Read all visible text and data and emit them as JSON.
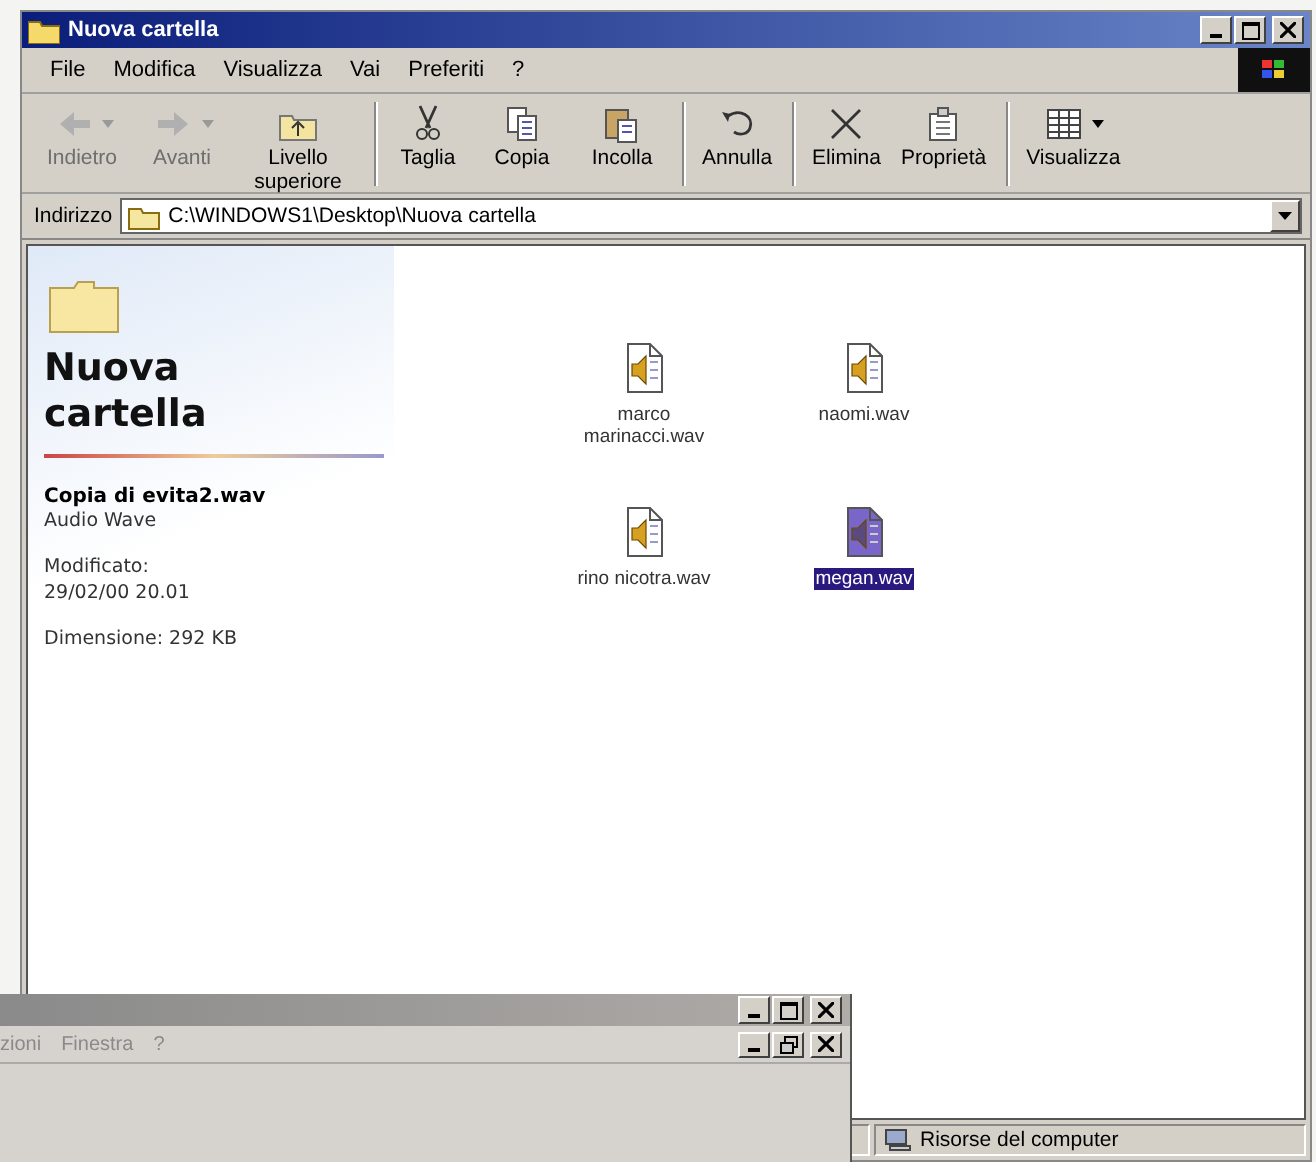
{
  "window": {
    "title": "Nuova cartella"
  },
  "menu": [
    {
      "label": "File"
    },
    {
      "label": "Modifica"
    },
    {
      "label": "Visualizza"
    },
    {
      "label": "Vai"
    },
    {
      "label": "Preferiti"
    },
    {
      "label": "?"
    }
  ],
  "toolbar": [
    {
      "kind": "back",
      "label": "Indietro",
      "disabled": true,
      "dropdown": true,
      "separator_before": false
    },
    {
      "kind": "forward",
      "label": "Avanti",
      "disabled": true,
      "dropdown": true,
      "separator_before": false
    },
    {
      "kind": "up",
      "label": "Livello superiore",
      "disabled": false,
      "dropdown": false,
      "separator_before": false
    },
    {
      "kind": "cut",
      "label": "Taglia",
      "disabled": false,
      "dropdown": false,
      "separator_before": true
    },
    {
      "kind": "copy",
      "label": "Copia",
      "disabled": false,
      "dropdown": false,
      "separator_before": false
    },
    {
      "kind": "paste",
      "label": "Incolla",
      "disabled": false,
      "dropdown": false,
      "separator_before": false
    },
    {
      "kind": "undo",
      "label": "Annulla",
      "disabled": false,
      "dropdown": false,
      "separator_before": true
    },
    {
      "kind": "delete",
      "label": "Elimina",
      "disabled": false,
      "dropdown": false,
      "separator_before": true
    },
    {
      "kind": "properties",
      "label": "Proprietà",
      "disabled": false,
      "dropdown": false,
      "separator_before": false
    },
    {
      "kind": "views",
      "label": "Visualizza",
      "disabled": false,
      "dropdown": true,
      "separator_before": true
    }
  ],
  "address": {
    "label": "Indirizzo",
    "value": "C:\\WINDOWS1\\Desktop\\Nuova cartella"
  },
  "panel": {
    "title": "Nuova cartella",
    "file_name": "Copia di evita2.wav",
    "file_type": "Audio Wave",
    "modified_label": "Modificato:",
    "modified_value": "29/02/00 20.01",
    "size": "Dimensione: 292 KB"
  },
  "files": [
    {
      "name": "marco marinacci.wav",
      "selected": false
    },
    {
      "name": "naomi.wav",
      "selected": false
    },
    {
      "name": "rino nicotra.wav",
      "selected": false
    },
    {
      "name": "megan.wav",
      "selected": true
    }
  ],
  "status_bar": {
    "location": "Risorse del computer"
  },
  "background_window": {
    "menu": [
      {
        "label": "zioni"
      },
      {
        "label": "Finestra"
      },
      {
        "label": "?"
      }
    ]
  }
}
